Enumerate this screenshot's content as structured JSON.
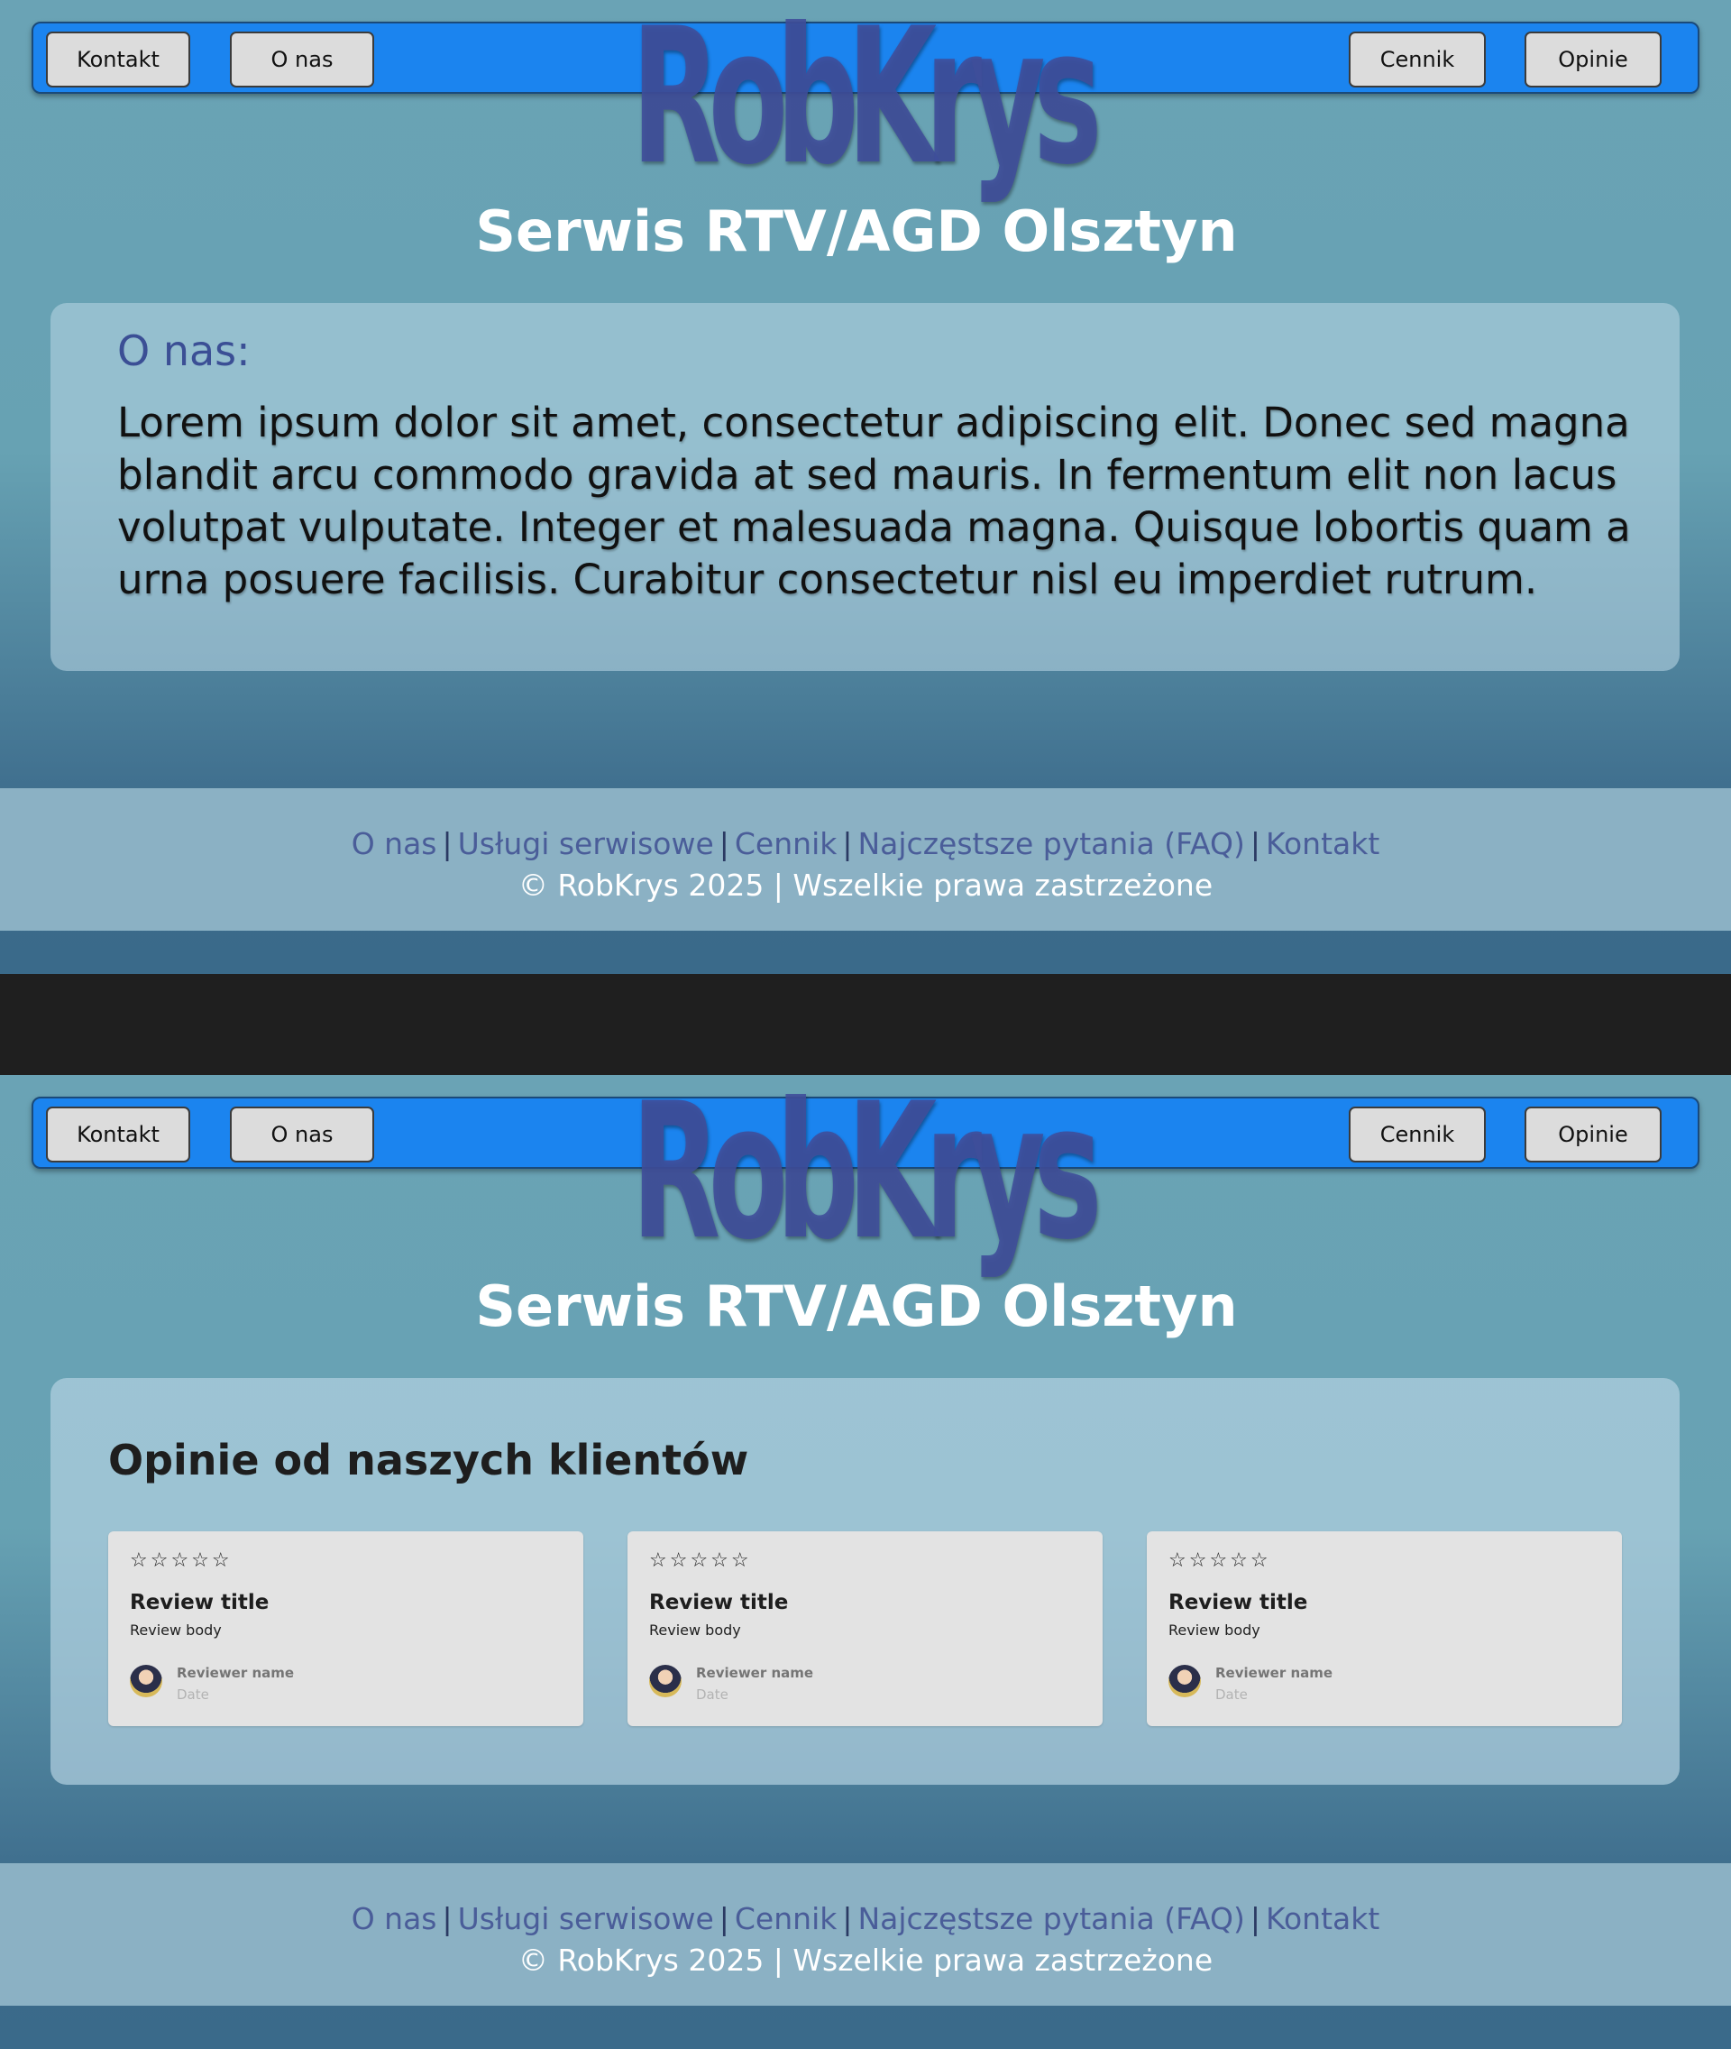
{
  "nav": {
    "kontakt": "Kontakt",
    "onas": "O nas",
    "cennik": "Cennik",
    "opinie": "Opinie"
  },
  "logo_text": "RobKrys",
  "site_title": "Serwis RTV/AGD Olsztyn",
  "about": {
    "heading": "O nas:",
    "text": "Lorem ipsum dolor sit amet, consectetur adipiscing elit. Donec sed magna blandit arcu commodo gravida at sed mauris. In fermentum elit non lacus volutpat vulputate. Integer et malesuada magna. Quisque lobortis quam a urna posuere facilisis. Curabitur consectetur nisl eu imperdiet rutrum."
  },
  "reviews": {
    "heading": "Opinie od naszych klientów",
    "items": [
      {
        "stars": "☆☆☆☆☆",
        "title": "Review title",
        "body": "Review body",
        "name": "Reviewer name",
        "date": "Date"
      },
      {
        "stars": "☆☆☆☆☆",
        "title": "Review title",
        "body": "Review body",
        "name": "Reviewer name",
        "date": "Date"
      },
      {
        "stars": "☆☆☆☆☆",
        "title": "Review title",
        "body": "Review body",
        "name": "Reviewer name",
        "date": "Date"
      }
    ]
  },
  "footer": {
    "links": [
      "O nas",
      "Usługi serwisowe",
      "Cennik",
      "Najczęstsze pytania (FAQ)",
      "Kontakt"
    ],
    "separator": "|",
    "copyright": "© RobKrys 2025 | Wszelkie prawa zastrzeżone"
  },
  "colors": {
    "navbar": "#1b84ef",
    "logo": "#3f4e9a",
    "footer": "#8bb1c4",
    "footer_link": "#4a5d99"
  }
}
